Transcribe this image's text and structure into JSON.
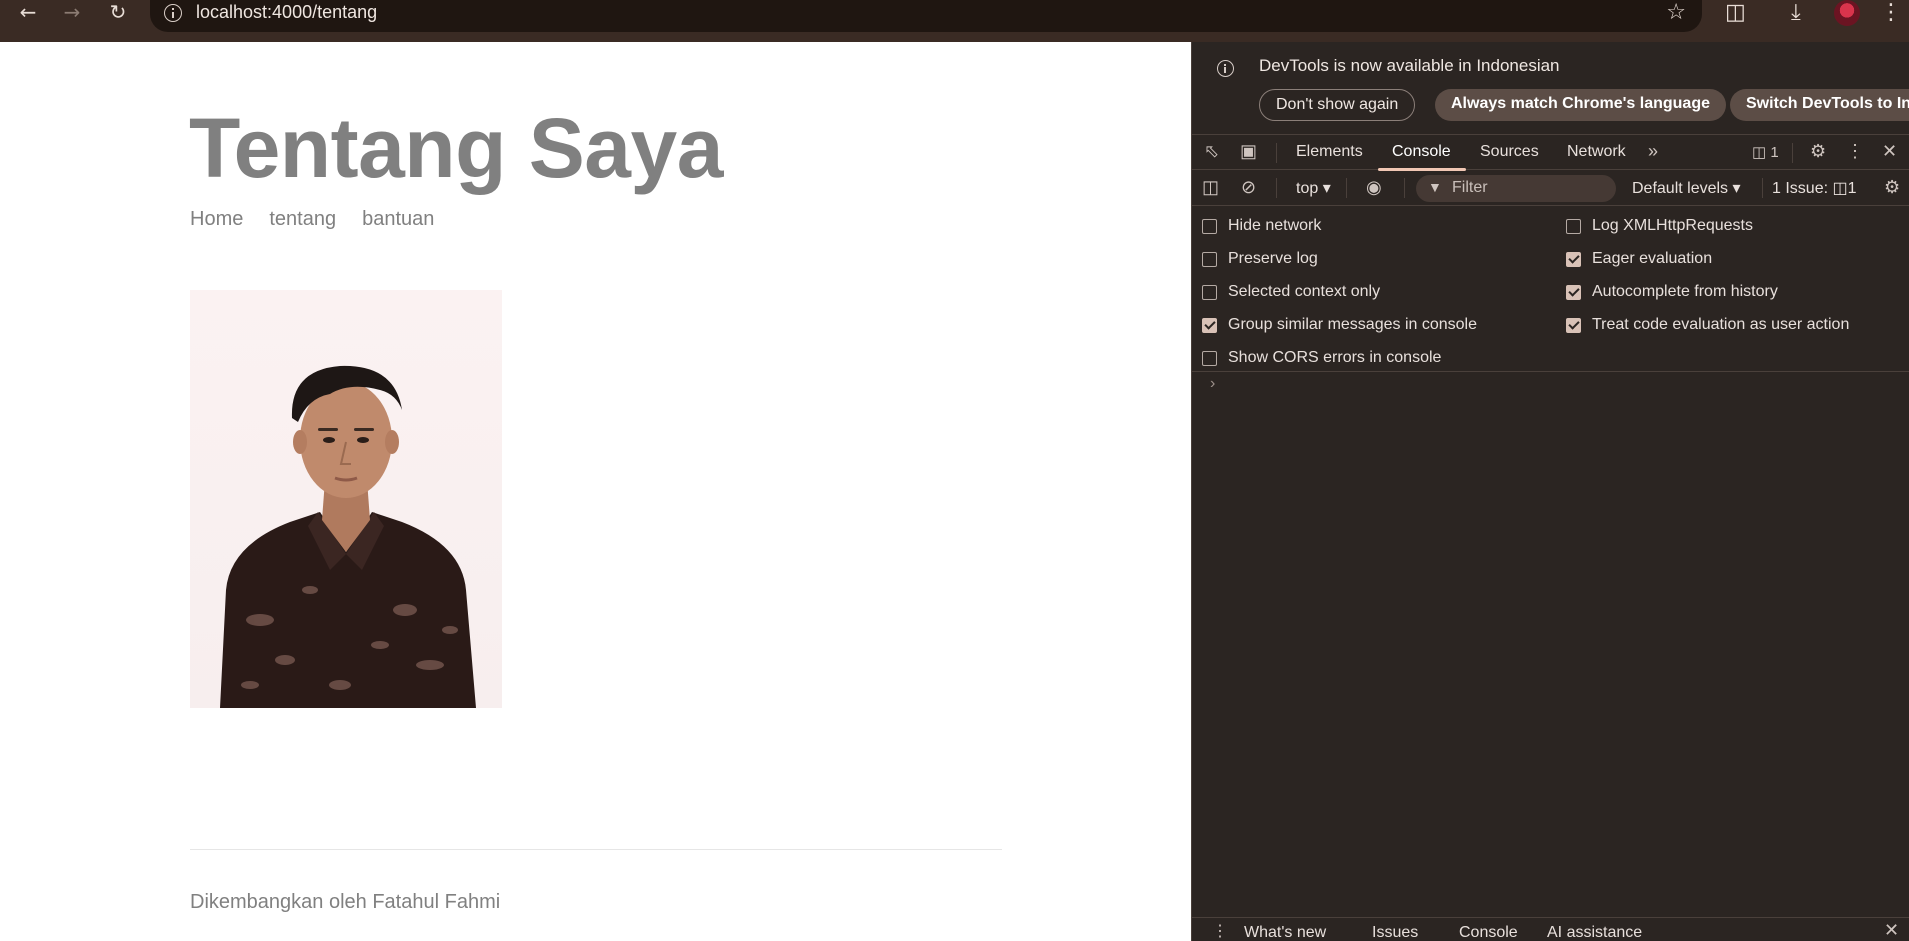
{
  "browser": {
    "url": "localhost:4000/tentang",
    "icons": [
      "back-icon",
      "forward-icon",
      "reload-icon",
      "site-info-icon",
      "bookmark-star-icon",
      "extensions-icon",
      "download-icon",
      "profile-avatar",
      "menu-icon"
    ]
  },
  "page": {
    "title": "Tentang Saya",
    "nav": [
      "Home",
      "tentang",
      "bantuan"
    ],
    "footer": "Dikembangkan oleh Fatahul Fahmi"
  },
  "devtools": {
    "notice": {
      "text": "DevTools is now available in Indonesian",
      "buttons": [
        "Don't show again",
        "Always match Chrome's language",
        "Switch DevTools to Inc"
      ]
    },
    "tabs": [
      "Elements",
      "Console",
      "Sources",
      "Network"
    ],
    "active_tab": "Console",
    "message_count": "1",
    "toolbar": {
      "context": "top",
      "filter_placeholder": "Filter",
      "levels": "Default levels",
      "issues_label": "1 Issue:",
      "issues_count": "1"
    },
    "settings_left": [
      {
        "label": "Hide network",
        "checked": false
      },
      {
        "label": "Preserve log",
        "checked": false
      },
      {
        "label": "Selected context only",
        "checked": false
      },
      {
        "label": "Group similar messages in console",
        "checked": true
      },
      {
        "label": "Show CORS errors in console",
        "checked": false
      }
    ],
    "settings_right": [
      {
        "label": "Log XMLHttpRequests",
        "checked": false
      },
      {
        "label": "Eager evaluation",
        "checked": true
      },
      {
        "label": "Autocomplete from history",
        "checked": true
      },
      {
        "label": "Treat code evaluation as user action",
        "checked": true
      }
    ],
    "drawer_tabs": [
      "What's new",
      "Issues",
      "Console",
      "AI assistance"
    ],
    "accent": "#f1c7b4"
  }
}
